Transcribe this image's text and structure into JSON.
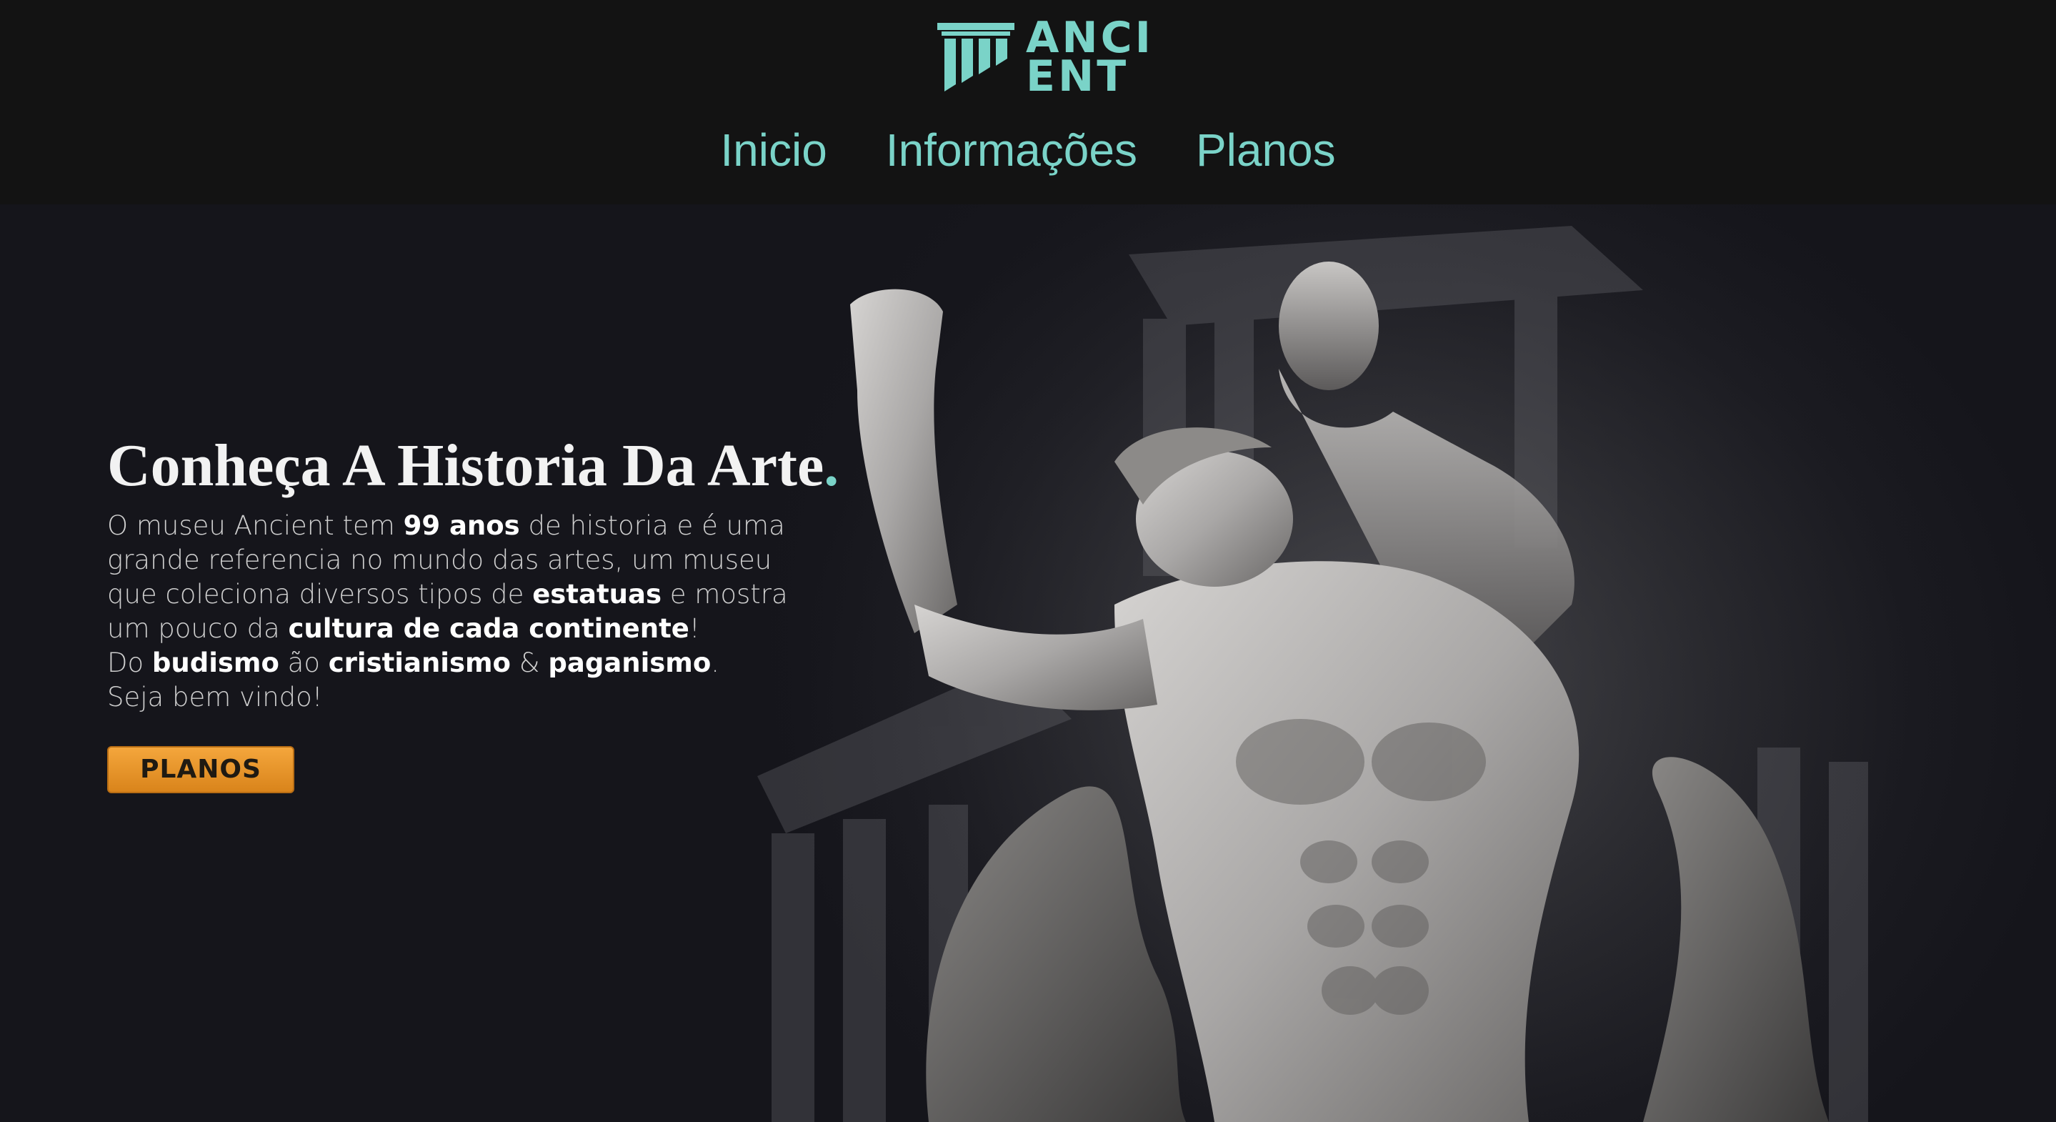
{
  "brand": {
    "logo_line1": "ANCI",
    "logo_line2": "ENT",
    "logo_icon": "column-icon",
    "accent_color": "#7ad3c8"
  },
  "nav": {
    "items": [
      {
        "label": "Inicio"
      },
      {
        "label": "Informações"
      },
      {
        "label": "Planos"
      }
    ]
  },
  "hero": {
    "title": "Conheça A Historia Da Arte",
    "title_dot": ".",
    "image": "statue-illustration",
    "text": {
      "l1_a": "O museu Ancient tem ",
      "l1_b": "99 anos",
      "l1_c": " de historia e é uma",
      "l2": "grande referencia no mundo das artes, um museu",
      "l3_a": "que coleciona diversos tipos de ",
      "l3_b": "estatuas",
      "l3_c": " e mostra",
      "l4_a": "um pouco da ",
      "l4_b": "cultura de cada continente",
      "l4_c": "!",
      "l5_a": "Do ",
      "l5_b": "budismo",
      "l5_c": " ão ",
      "l5_d": "cristianismo",
      "l5_e": " & ",
      "l5_f": "paganismo",
      "l5_g": ".",
      "l6": "Seja bem vindo!"
    },
    "cta_label": "PLANOS",
    "cta_color": "#f0a033"
  }
}
